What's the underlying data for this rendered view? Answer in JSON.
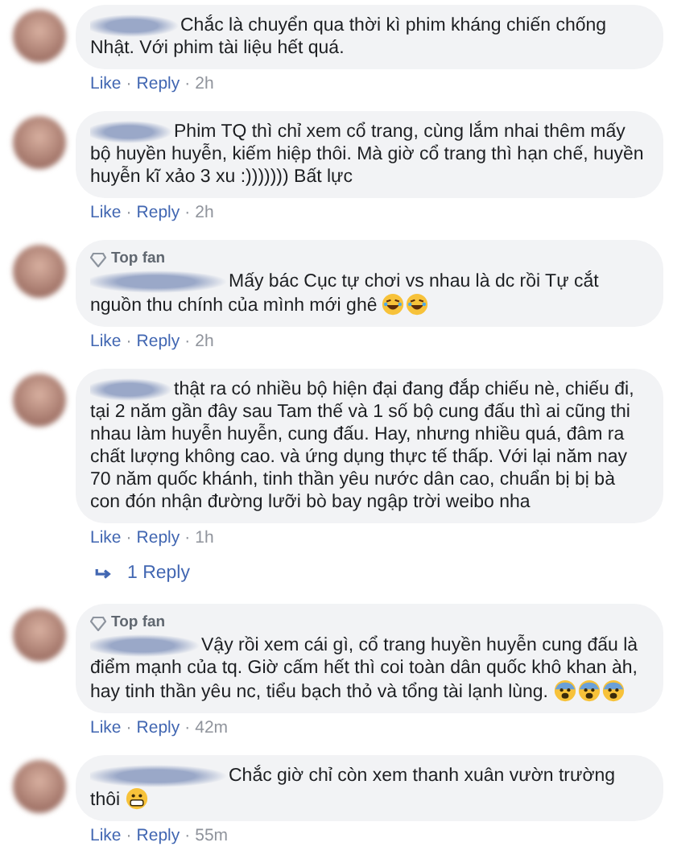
{
  "comments": [
    {
      "text": "Chắc là chuyển qua thời kì phim kháng chiến chống Nhật. Với phim tài liệu hết quá.",
      "footer": [
        {
          "kind": "link",
          "text": "Like"
        },
        {
          "kind": "dot",
          "text": "·"
        },
        {
          "kind": "link",
          "text": "Reply"
        },
        {
          "kind": "dot",
          "text": "·"
        },
        {
          "kind": "time",
          "text": "2h"
        }
      ]
    },
    {
      "text": "Phim TQ thì chỉ xem cổ trang, cùng lắm nhai thêm mấy bộ huyền huyễn, kiếm hiệp thôi. Mà giờ cổ trang thì hạn chế, huyền huyễn kĩ xảo 3 xu :))))))) Bất lực",
      "footer": [
        {
          "kind": "link",
          "text": "Like"
        },
        {
          "kind": "dot",
          "text": "·"
        },
        {
          "kind": "link",
          "text": "Reply"
        },
        {
          "kind": "dot",
          "text": "·"
        },
        {
          "kind": "time",
          "text": "2h"
        }
      ]
    },
    {
      "badge": "Top fan",
      "text": "Mấy bác Cục tự chơi vs nhau là dc rồi Tự cắt nguồn thu chính của mình mới ghê",
      "emojis": [
        {
          "kind": "laugh"
        },
        {
          "kind": "laugh"
        }
      ],
      "footer": [
        {
          "kind": "link",
          "text": "Like"
        },
        {
          "kind": "dot",
          "text": "·"
        },
        {
          "kind": "link",
          "text": "Reply"
        },
        {
          "kind": "dot",
          "text": "·"
        },
        {
          "kind": "time",
          "text": "2h"
        }
      ]
    },
    {
      "text": "thật ra có nhiều bộ hiện đại đang đắp chiếu nè, chiếu đi, tại 2 năm gần đây sau Tam thế và 1 số bộ cung đấu thì ai cũng thi nhau làm huyễn huyễn, cung đấu. Hay, nhưng nhiều quá, đâm ra chất lượng không cao. và ứng dụng thực tế thấp. Với lại năm nay 70 năm quốc khánh, tinh thần yêu nước dân cao, chuẩn bị bị bà con đón nhận đường lưỡi bò bay ngập trời weibo nha",
      "footer": [
        {
          "kind": "link",
          "text": "Like"
        },
        {
          "kind": "dot",
          "text": "·"
        },
        {
          "kind": "link",
          "text": "Reply"
        },
        {
          "kind": "dot",
          "text": "·"
        },
        {
          "kind": "time",
          "text": "1h"
        }
      ],
      "replies_link": "1 Reply"
    },
    {
      "badge": "Top fan",
      "text": "Vậy rồi xem cái gì, cổ trang huyền huyễn cung đấu là điểm mạnh của tq. Giờ cấm hết thì coi toàn dân quốc khô khan àh, hay tinh thần yêu nc, tiểu bạch thỏ và tổng tài lạnh lùng.",
      "emojis": [
        {
          "kind": "fear"
        },
        {
          "kind": "fear"
        },
        {
          "kind": "fear"
        }
      ],
      "footer": [
        {
          "kind": "link",
          "text": "Like"
        },
        {
          "kind": "dot",
          "text": "·"
        },
        {
          "kind": "link",
          "text": "Reply"
        },
        {
          "kind": "dot",
          "text": "·"
        },
        {
          "kind": "time",
          "text": "42m"
        }
      ]
    },
    {
      "text": "Chắc giờ chỉ còn xem thanh xuân vườn trường thôi",
      "emojis": [
        {
          "kind": "grimace"
        }
      ],
      "footer": [
        {
          "kind": "link",
          "text": "Like"
        },
        {
          "kind": "dot",
          "text": "·"
        },
        {
          "kind": "link",
          "text": "Reply"
        },
        {
          "kind": "dot",
          "text": "·"
        },
        {
          "kind": "time",
          "text": "55m"
        }
      ]
    }
  ]
}
